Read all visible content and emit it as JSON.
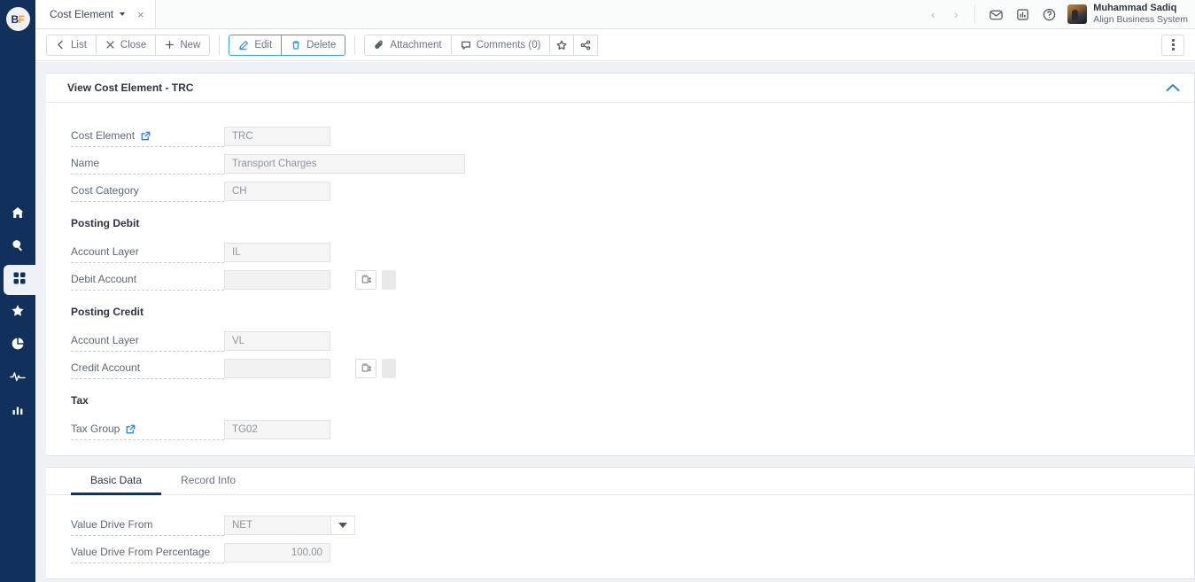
{
  "brand": {
    "logo_b": "B",
    "logo_f": "F",
    "accent": "#2e86de",
    "rail_bg": "#12305c"
  },
  "sidebar": {
    "items": [
      {
        "name": "home",
        "label": "Home",
        "active": false
      },
      {
        "name": "search",
        "label": "Search",
        "active": false
      },
      {
        "name": "apps",
        "label": "Apps",
        "active": true
      },
      {
        "name": "favorites",
        "label": "Favorites",
        "active": false
      },
      {
        "name": "reports",
        "label": "Reports",
        "active": false
      },
      {
        "name": "activity",
        "label": "Activity",
        "active": false
      },
      {
        "name": "analytics",
        "label": "Analytics",
        "active": false
      }
    ]
  },
  "header": {
    "tab": {
      "label": "Cost Element",
      "close": "×"
    },
    "prev": "‹",
    "next": "›",
    "icons": [
      {
        "name": "mail-icon",
        "label": "Messages"
      },
      {
        "name": "chart-icon",
        "label": "Reports"
      },
      {
        "name": "help-icon",
        "label": "Help"
      }
    ],
    "user": {
      "name": "Muhammad Sadiq",
      "org": "Align Business System"
    }
  },
  "toolbar": {
    "list_label": "List",
    "close_label": "Close",
    "new_label": "New",
    "edit_label": "Edit",
    "delete_label": "Delete",
    "attachment_label": "Attachment",
    "comments_label": "Comments (0)",
    "favorite_icon": "star-icon",
    "share_icon": "share-icon",
    "more_icon": "kebab-icon"
  },
  "panel": {
    "title": "View Cost Element - TRC",
    "collapse_icon": "chevron-up-icon",
    "fields": [
      {
        "label": "Cost Element",
        "value": "TRC",
        "width": "w120",
        "external": true
      },
      {
        "label": "Name",
        "value": "Transport Charges",
        "width": "w272",
        "external": false
      },
      {
        "label": "Cost Category",
        "value": "CH",
        "width": "w120",
        "external": false
      }
    ],
    "posting_debit": {
      "heading": "Posting Debit",
      "account_layer_label": "Account Layer",
      "account_layer_value": "IL",
      "debit_account_label": "Debit Account",
      "debit_account_value": "",
      "lookup_icon": "lookup-icon"
    },
    "posting_credit": {
      "heading": "Posting Credit",
      "account_layer_label": "Account Layer",
      "account_layer_value": "VL",
      "credit_account_label": "Credit Account",
      "credit_account_value": "",
      "lookup_icon": "lookup-icon"
    },
    "tax": {
      "heading": "Tax",
      "tax_group_label": "Tax Group",
      "tax_group_value": "TG02"
    }
  },
  "bottom": {
    "tabs": [
      {
        "label": "Basic Data",
        "active": true
      },
      {
        "label": "Record Info",
        "active": false
      }
    ],
    "fields": [
      {
        "label": "Value Drive From",
        "value": "NET",
        "type": "select"
      },
      {
        "label": "Value Drive From Percentage",
        "value": "100.00",
        "type": "number"
      }
    ]
  }
}
